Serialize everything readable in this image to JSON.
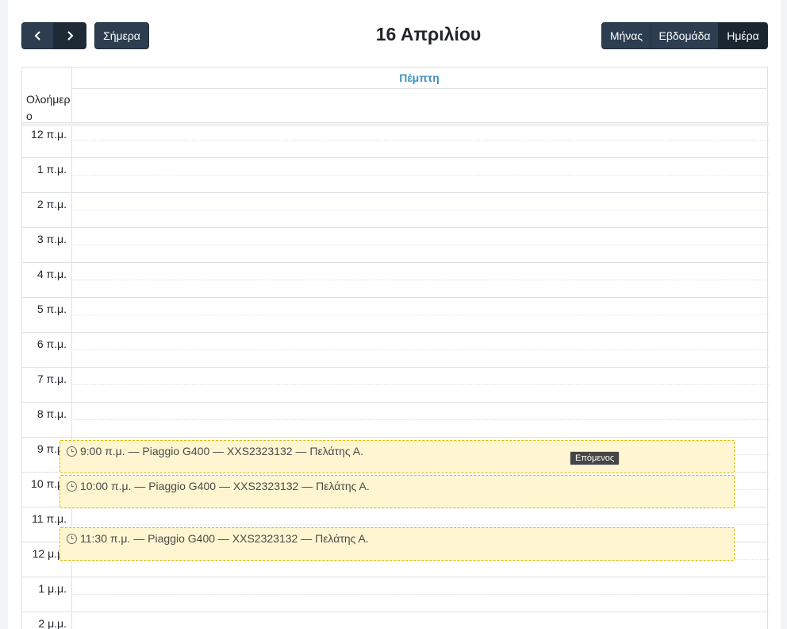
{
  "toolbar": {
    "prev_icon": "chevron-left-icon",
    "next_icon": "chevron-right-icon",
    "today_label": "Σήμερα",
    "title": "16 Απριλίου",
    "views": {
      "month": "Μήνας",
      "week": "Εβδομάδα",
      "day": "Ημέρα"
    },
    "active_view": "day"
  },
  "grid": {
    "column_header": "Πέμπτη",
    "allday_label": "Ολοήμερο",
    "hours": [
      "12 π.μ.",
      "1 π.μ.",
      "2 π.μ.",
      "3 π.μ.",
      "4 π.μ.",
      "5 π.μ.",
      "6 π.μ.",
      "7 π.μ.",
      "8 π.μ.",
      "9 π.μ.",
      "10 π.μ.",
      "11 π.μ.",
      "12 μ.μ.",
      "1 μ.μ.",
      "2 μ.μ."
    ]
  },
  "events": [
    {
      "text": "9:00 π.μ. — Piaggio G400 — XXS2323132 — Πελάτης Α.",
      "icon": "clock-icon"
    },
    {
      "text": "10:00 π.μ. — Piaggio G400 — XXS2323132 — Πελάτης Α.",
      "icon": "clock-icon"
    },
    {
      "text": "11:30 π.μ. — Piaggio G400 — XXS2323132 — Πελάτης Α.",
      "icon": "clock-icon"
    }
  ],
  "tooltip": "Επόμενος",
  "colors": {
    "primary_button": "#2c3e50",
    "active_button": "#1a252f",
    "header_text": "#3e92c0",
    "event_bg": "#fff6d1",
    "event_border": "#d9b800"
  }
}
